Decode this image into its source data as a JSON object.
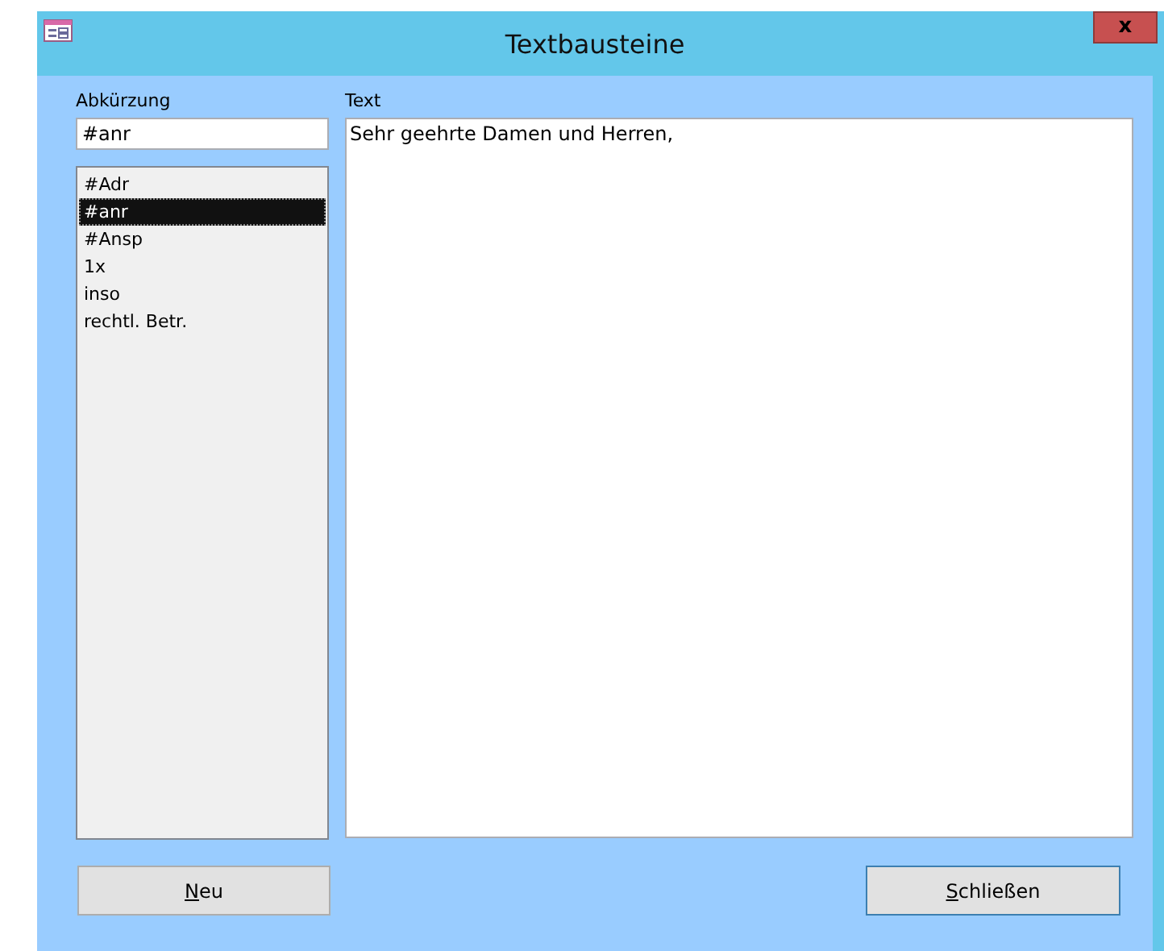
{
  "window": {
    "title": "Textbausteine",
    "close_label": "x"
  },
  "abbreviation": {
    "label": "Abkürzung",
    "value": "#anr"
  },
  "list": {
    "items": [
      {
        "label": "#Adr",
        "selected": false
      },
      {
        "label": "#anr",
        "selected": true
      },
      {
        "label": "#Ansp",
        "selected": false
      },
      {
        "label": "1x",
        "selected": false
      },
      {
        "label": "inso",
        "selected": false
      },
      {
        "label": "rechtl. Betr.",
        "selected": false
      }
    ]
  },
  "text": {
    "label": "Text",
    "value": "Sehr geehrte Damen und Herren,"
  },
  "buttons": [
    {
      "label": "Neu",
      "mnemonic": true
    },
    {
      "label": "Schließen",
      "mnemonic": true
    }
  ]
}
